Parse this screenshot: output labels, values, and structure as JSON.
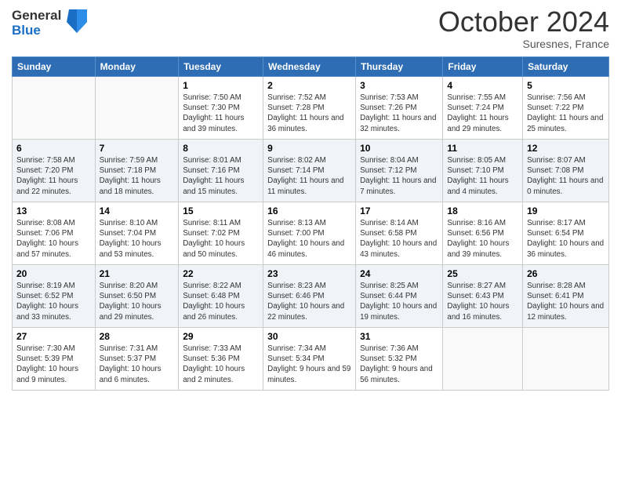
{
  "header": {
    "logo_line1": "General",
    "logo_line2": "Blue",
    "month": "October 2024",
    "location": "Suresnes, France"
  },
  "weekdays": [
    "Sunday",
    "Monday",
    "Tuesday",
    "Wednesday",
    "Thursday",
    "Friday",
    "Saturday"
  ],
  "weeks": [
    [
      {
        "day": "",
        "info": ""
      },
      {
        "day": "",
        "info": ""
      },
      {
        "day": "1",
        "info": "Sunrise: 7:50 AM\nSunset: 7:30 PM\nDaylight: 11 hours and 39 minutes."
      },
      {
        "day": "2",
        "info": "Sunrise: 7:52 AM\nSunset: 7:28 PM\nDaylight: 11 hours and 36 minutes."
      },
      {
        "day": "3",
        "info": "Sunrise: 7:53 AM\nSunset: 7:26 PM\nDaylight: 11 hours and 32 minutes."
      },
      {
        "day": "4",
        "info": "Sunrise: 7:55 AM\nSunset: 7:24 PM\nDaylight: 11 hours and 29 minutes."
      },
      {
        "day": "5",
        "info": "Sunrise: 7:56 AM\nSunset: 7:22 PM\nDaylight: 11 hours and 25 minutes."
      }
    ],
    [
      {
        "day": "6",
        "info": "Sunrise: 7:58 AM\nSunset: 7:20 PM\nDaylight: 11 hours and 22 minutes."
      },
      {
        "day": "7",
        "info": "Sunrise: 7:59 AM\nSunset: 7:18 PM\nDaylight: 11 hours and 18 minutes."
      },
      {
        "day": "8",
        "info": "Sunrise: 8:01 AM\nSunset: 7:16 PM\nDaylight: 11 hours and 15 minutes."
      },
      {
        "day": "9",
        "info": "Sunrise: 8:02 AM\nSunset: 7:14 PM\nDaylight: 11 hours and 11 minutes."
      },
      {
        "day": "10",
        "info": "Sunrise: 8:04 AM\nSunset: 7:12 PM\nDaylight: 11 hours and 7 minutes."
      },
      {
        "day": "11",
        "info": "Sunrise: 8:05 AM\nSunset: 7:10 PM\nDaylight: 11 hours and 4 minutes."
      },
      {
        "day": "12",
        "info": "Sunrise: 8:07 AM\nSunset: 7:08 PM\nDaylight: 11 hours and 0 minutes."
      }
    ],
    [
      {
        "day": "13",
        "info": "Sunrise: 8:08 AM\nSunset: 7:06 PM\nDaylight: 10 hours and 57 minutes."
      },
      {
        "day": "14",
        "info": "Sunrise: 8:10 AM\nSunset: 7:04 PM\nDaylight: 10 hours and 53 minutes."
      },
      {
        "day": "15",
        "info": "Sunrise: 8:11 AM\nSunset: 7:02 PM\nDaylight: 10 hours and 50 minutes."
      },
      {
        "day": "16",
        "info": "Sunrise: 8:13 AM\nSunset: 7:00 PM\nDaylight: 10 hours and 46 minutes."
      },
      {
        "day": "17",
        "info": "Sunrise: 8:14 AM\nSunset: 6:58 PM\nDaylight: 10 hours and 43 minutes."
      },
      {
        "day": "18",
        "info": "Sunrise: 8:16 AM\nSunset: 6:56 PM\nDaylight: 10 hours and 39 minutes."
      },
      {
        "day": "19",
        "info": "Sunrise: 8:17 AM\nSunset: 6:54 PM\nDaylight: 10 hours and 36 minutes."
      }
    ],
    [
      {
        "day": "20",
        "info": "Sunrise: 8:19 AM\nSunset: 6:52 PM\nDaylight: 10 hours and 33 minutes."
      },
      {
        "day": "21",
        "info": "Sunrise: 8:20 AM\nSunset: 6:50 PM\nDaylight: 10 hours and 29 minutes."
      },
      {
        "day": "22",
        "info": "Sunrise: 8:22 AM\nSunset: 6:48 PM\nDaylight: 10 hours and 26 minutes."
      },
      {
        "day": "23",
        "info": "Sunrise: 8:23 AM\nSunset: 6:46 PM\nDaylight: 10 hours and 22 minutes."
      },
      {
        "day": "24",
        "info": "Sunrise: 8:25 AM\nSunset: 6:44 PM\nDaylight: 10 hours and 19 minutes."
      },
      {
        "day": "25",
        "info": "Sunrise: 8:27 AM\nSunset: 6:43 PM\nDaylight: 10 hours and 16 minutes."
      },
      {
        "day": "26",
        "info": "Sunrise: 8:28 AM\nSunset: 6:41 PM\nDaylight: 10 hours and 12 minutes."
      }
    ],
    [
      {
        "day": "27",
        "info": "Sunrise: 7:30 AM\nSunset: 5:39 PM\nDaylight: 10 hours and 9 minutes."
      },
      {
        "day": "28",
        "info": "Sunrise: 7:31 AM\nSunset: 5:37 PM\nDaylight: 10 hours and 6 minutes."
      },
      {
        "day": "29",
        "info": "Sunrise: 7:33 AM\nSunset: 5:36 PM\nDaylight: 10 hours and 2 minutes."
      },
      {
        "day": "30",
        "info": "Sunrise: 7:34 AM\nSunset: 5:34 PM\nDaylight: 9 hours and 59 minutes."
      },
      {
        "day": "31",
        "info": "Sunrise: 7:36 AM\nSunset: 5:32 PM\nDaylight: 9 hours and 56 minutes."
      },
      {
        "day": "",
        "info": ""
      },
      {
        "day": "",
        "info": ""
      }
    ]
  ]
}
